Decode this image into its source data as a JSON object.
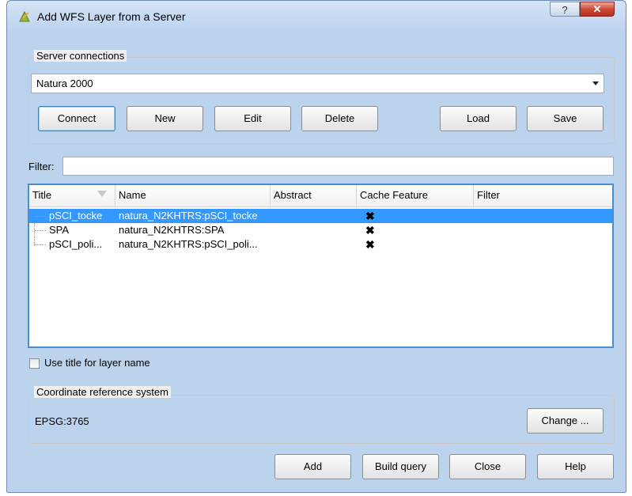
{
  "window": {
    "title": "Add WFS Layer from a Server",
    "help_glyph": "?",
    "close_glyph": "✕"
  },
  "server_connections": {
    "group_label": "Server connections",
    "selected_connection": "Natura 2000",
    "buttons": {
      "connect": "Connect",
      "new": "New",
      "edit": "Edit",
      "delete": "Delete",
      "load": "Load",
      "save": "Save"
    }
  },
  "filter": {
    "label": "Filter:",
    "value": ""
  },
  "layers_table": {
    "columns": [
      "Title",
      "Name",
      "Abstract",
      "Cache Feature",
      "Filter"
    ],
    "rows": [
      {
        "title": "pSCI_tocke",
        "name": "natura_N2KHTRS:pSCI_tocke",
        "abstract": "",
        "cache_feature": "✖",
        "filter": "",
        "selected": true
      },
      {
        "title": "SPA",
        "name": "natura_N2KHTRS:SPA",
        "abstract": "",
        "cache_feature": "✖",
        "filter": "",
        "selected": false
      },
      {
        "title": "pSCI_poli...",
        "name": "natura_N2KHTRS:pSCI_poli...",
        "abstract": "",
        "cache_feature": "✖",
        "filter": "",
        "selected": false
      }
    ]
  },
  "use_title_checkbox": {
    "label": "Use title for layer name",
    "checked": false
  },
  "crs": {
    "group_label": "Coordinate reference system",
    "value": "EPSG:3765",
    "change_label": "Change ..."
  },
  "footer_buttons": {
    "add": "Add",
    "build_query": "Build query",
    "close": "Close",
    "help": "Help"
  },
  "colors": {
    "selection": "#3399ff",
    "table_focus_border": "#4a8ed1",
    "close_button": "#c9452f"
  }
}
